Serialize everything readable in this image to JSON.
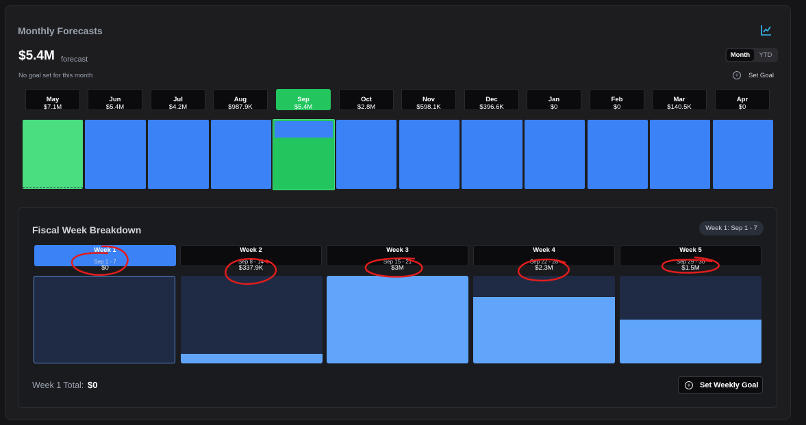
{
  "header": {
    "title": "Monthly Forecasts",
    "amount": "$5.4M",
    "amount_label": "forecast",
    "goal_note": "No goal set for this month",
    "toggle": {
      "month": "Month",
      "ytd": "YTD",
      "selected": "Month"
    },
    "set_goal_label": "Set Goal",
    "chart_icon": "line-chart-icon"
  },
  "months": [
    {
      "name": "May",
      "value": "$7.1M",
      "state": "past"
    },
    {
      "name": "Jun",
      "value": "$5.4M",
      "state": "future"
    },
    {
      "name": "Jul",
      "value": "$4.2M",
      "state": "future"
    },
    {
      "name": "Aug",
      "value": "$987.9K",
      "state": "future"
    },
    {
      "name": "Sep",
      "value": "$5.4M",
      "state": "current"
    },
    {
      "name": "Oct",
      "value": "$2.8M",
      "state": "future"
    },
    {
      "name": "Nov",
      "value": "$598.1K",
      "state": "future"
    },
    {
      "name": "Dec",
      "value": "$396.6K",
      "state": "future"
    },
    {
      "name": "Jan",
      "value": "$0",
      "state": "future"
    },
    {
      "name": "Feb",
      "value": "$0",
      "state": "future"
    },
    {
      "name": "Mar",
      "value": "$140.5K",
      "state": "future"
    },
    {
      "name": "Apr",
      "value": "$0",
      "state": "future"
    }
  ],
  "weeks_section": {
    "title": "Fiscal Week Breakdown",
    "badge": "Week 1: Sep 1 - 7",
    "weeks": [
      {
        "name": "Week 1",
        "range": "Sep 1 - 7",
        "value": "$0",
        "fill": 0.0
      },
      {
        "name": "Week 2",
        "range": "Sep 8 - 14",
        "value": "$337.9K",
        "fill": 0.11
      },
      {
        "name": "Week 3",
        "range": "Sep 15 - 21",
        "value": "$3M",
        "fill": 1.0
      },
      {
        "name": "Week 4",
        "range": "Sep 22 - 28",
        "value": "$2.3M",
        "fill": 0.76
      },
      {
        "name": "Week 5",
        "range": "Sep 29 - 30",
        "value": "$1.5M",
        "fill": 0.5
      }
    ],
    "total_label": "Week 1 Total:",
    "total_value": "$0",
    "set_weekly_goal_label": "Set Weekly Goal"
  },
  "colors": {
    "accent_blue": "#3b82f6",
    "current_green": "#22c55e",
    "past_green": "#4ade80",
    "week_fill": "#60a5fa",
    "annotation_red": "#e11d1d"
  }
}
